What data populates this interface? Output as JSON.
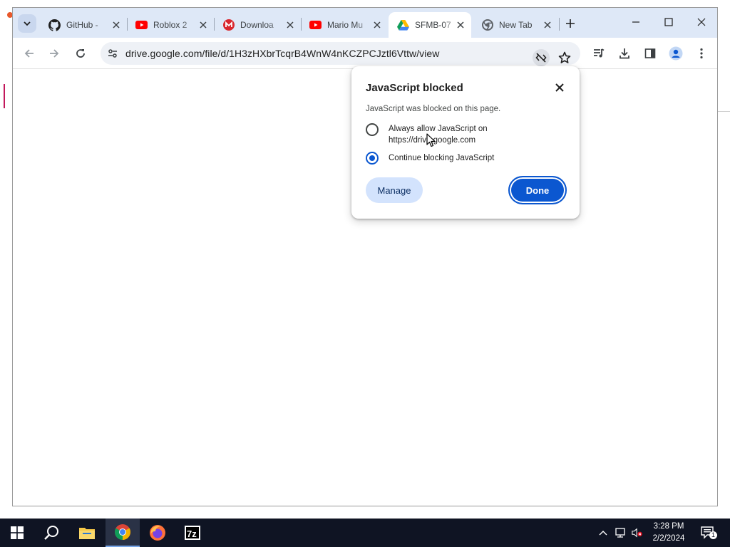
{
  "browser": {
    "tabs": [
      {
        "title": "GitHub -",
        "icon": "github-icon"
      },
      {
        "title": "Roblox 2",
        "icon": "youtube-icon"
      },
      {
        "title": "Downloa",
        "icon": "mega-icon"
      },
      {
        "title": "Mario Mu",
        "icon": "youtube-icon"
      },
      {
        "title": "SFMB-07",
        "icon": "google-drive-icon",
        "active": true
      },
      {
        "title": "New Tab",
        "icon": "chrome-icon"
      }
    ],
    "url": "drive.google.com/file/d/1H3zHXbrTcqrB4WnW4nKCZPCJztl6Vttw/view"
  },
  "popup": {
    "title": "JavaScript blocked",
    "description": "JavaScript was blocked on this page.",
    "option_allow": "Always allow JavaScript on https://drive.google.com",
    "option_block": "Continue blocking JavaScript",
    "selected": "block",
    "manage_label": "Manage",
    "done_label": "Done"
  },
  "taskbar": {
    "time": "3:28 PM",
    "date": "2/2/2024",
    "notification_count": "1",
    "apps": [
      "windows-start",
      "search",
      "file-explorer",
      "chrome",
      "firefox",
      "7-zip"
    ]
  },
  "colors": {
    "accent": "#0b57d0",
    "tabstrip": "#dee8f7",
    "taskbar": "#0f1423"
  }
}
